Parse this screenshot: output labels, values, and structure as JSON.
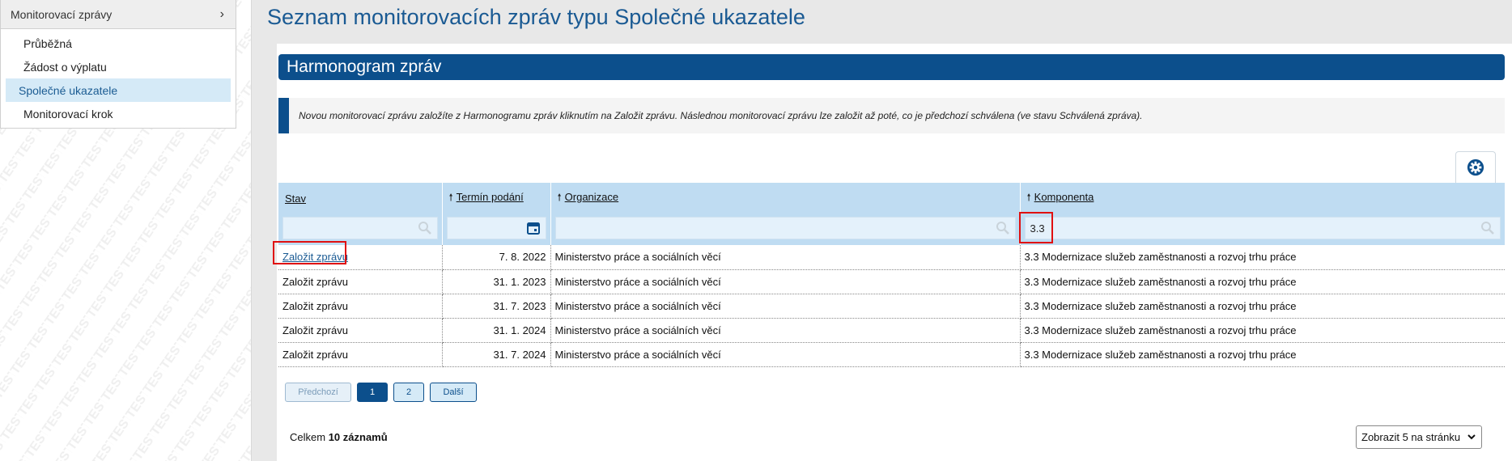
{
  "sidebar": {
    "watermark_text": "TEST",
    "header_label": "Monitorovací zprávy",
    "items": [
      {
        "label": "Průběžná"
      },
      {
        "label": "Žádost o výplatu"
      },
      {
        "label": "Společné ukazatele"
      },
      {
        "label": "Monitorovací krok"
      }
    ]
  },
  "page": {
    "title": "Seznam monitorovacích zpráv typu Společné ukazatele",
    "section_title": "Harmonogram zpráv",
    "info_text": "Novou monitorovací zprávu založíte z Harmonogramu zpráv kliknutím na Založit zprávu. Následnou monitorovací zprávu lze založit až poté, co je předchozí schválena (ve stavu Schválená zpráva)."
  },
  "table": {
    "columns": [
      {
        "label": "Stav"
      },
      {
        "label": "Termín podání"
      },
      {
        "label": "Organizace"
      },
      {
        "label": "Komponenta"
      }
    ],
    "filters": {
      "komponenta_value": "3.3"
    },
    "rows": [
      {
        "stav": "Založit zprávu",
        "termin": "7. 8. 2022",
        "organizace": "Ministerstvo práce a sociálních věcí",
        "komponenta": "3.3 Modernizace služeb zaměstnanosti a rozvoj trhu práce"
      },
      {
        "stav": "Založit zprávu",
        "termin": "31. 1. 2023",
        "organizace": "Ministerstvo práce a sociálních věcí",
        "komponenta": "3.3 Modernizace služeb zaměstnanosti a rozvoj trhu práce"
      },
      {
        "stav": "Založit zprávu",
        "termin": "31. 7. 2023",
        "organizace": "Ministerstvo práce a sociálních věcí",
        "komponenta": "3.3 Modernizace služeb zaměstnanosti a rozvoj trhu práce"
      },
      {
        "stav": "Založit zprávu",
        "termin": "31. 1. 2024",
        "organizace": "Ministerstvo práce a sociálních věcí",
        "komponenta": "3.3 Modernizace služeb zaměstnanosti a rozvoj trhu práce"
      },
      {
        "stav": "Založit zprávu",
        "termin": "31. 7. 2024",
        "organizace": "Ministerstvo práce a sociálních věcí",
        "komponenta": "3.3 Modernizace služeb zaměstnanosti a rozvoj trhu práce"
      }
    ]
  },
  "pager": {
    "prev_label": "Předchozí",
    "page1": "1",
    "page2": "2",
    "next_label": "Další"
  },
  "footer": {
    "total_prefix": "Celkem",
    "total_count": "10 záznamů",
    "per_page_label": "Zobrazit 5 na stránku"
  },
  "colors": {
    "brand_blue": "#0c4f8c",
    "header_blue": "#bfdcf2",
    "highlight_red": "#e01010"
  }
}
